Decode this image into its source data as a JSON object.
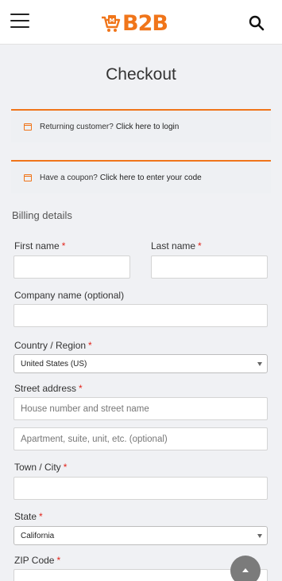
{
  "header": {
    "menu_icon": "hamburger-icon",
    "logo_text": "B2B",
    "logo_icon": "shopping-cart-icon",
    "search_icon": "search-icon",
    "brand_color": "#f0751a"
  },
  "page": {
    "title": "Checkout"
  },
  "notices": {
    "returning": {
      "text": "Returning customer?",
      "link": "Click here to login",
      "icon": "calendar-icon"
    },
    "coupon": {
      "text": "Have a coupon?",
      "link": "Click here to enter your code",
      "icon": "calendar-icon"
    }
  },
  "billing": {
    "title": "Billing details",
    "required_mark": "*",
    "first_name": {
      "label": "First name",
      "value": ""
    },
    "last_name": {
      "label": "Last name",
      "value": ""
    },
    "company": {
      "label": "Company name (optional)",
      "value": ""
    },
    "country": {
      "label": "Country / Region",
      "selected": "United States (US)"
    },
    "street": {
      "label": "Street address",
      "placeholder1": "House number and street name",
      "placeholder2": "Apartment, suite, unit, etc. (optional)"
    },
    "town": {
      "label": "Town / City",
      "value": ""
    },
    "state": {
      "label": "State",
      "selected": "California"
    },
    "zip": {
      "label": "ZIP Code",
      "value": ""
    }
  },
  "scroll_top_icon": "chevron-up-icon"
}
